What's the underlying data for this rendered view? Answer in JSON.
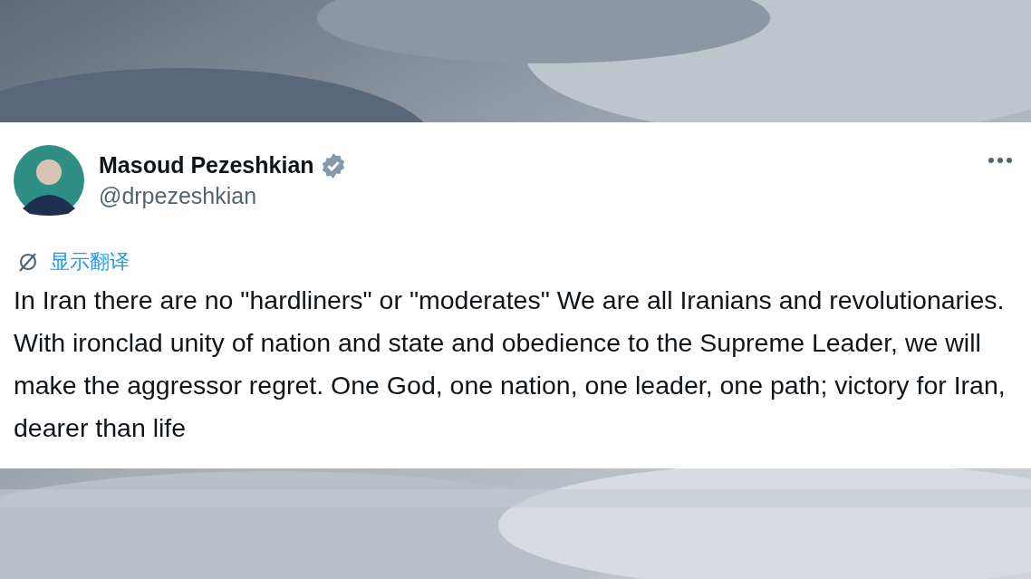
{
  "post": {
    "author": {
      "name": "Masoud Pezeshkian",
      "verified": true,
      "handle": "@drpezeshkian"
    },
    "translate_link": "显示翻译",
    "text": "In Iran there are no \"hardliners\" or \"moderates\" We are all Iranians and revolutionaries. With ironclad unity of nation and state and obedience to the Supreme Leader, we will make the aggressor regret. One God, one nation, one leader, one path; victory for Iran, dearer than life"
  }
}
